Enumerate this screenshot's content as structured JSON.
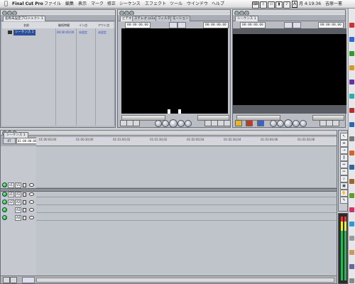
{
  "menubar": {
    "app_name": "Final Cut Pro",
    "items": [
      "ファイル",
      "編集",
      "表示",
      "マーク",
      "修正",
      "シーケンス",
      "エフェクト",
      "ツール",
      "ウインドウ",
      "ヘルプ"
    ],
    "status_a": "A",
    "time": "月 4:19:36",
    "user": "吉原一憲"
  },
  "browser": {
    "title": "ブラウザ",
    "tab_label": "名称未設定プロジェクト 1",
    "columns": [
      "名前",
      "継続時間",
      "イン点",
      "アウト点"
    ],
    "rows": [
      {
        "name": "シーケンス 1",
        "duration": "00:00:00;00",
        "in": "未設定",
        "out": "未設定"
      }
    ]
  },
  "viewer": {
    "tabs": [
      "ビデオ",
      "ステレオ (a1a2)",
      "フィルタ",
      "モーション"
    ],
    "timecode_left": "00:00:00;00",
    "timecode_right": "00:00:00;00"
  },
  "canvas": {
    "tab_label": "シーケンス 1",
    "timecode_left": "00:00:00;00",
    "timecode_right": "00:00:00;00"
  },
  "timeline": {
    "sequence_tab": "シーケンス 1",
    "rt_label": "RT",
    "timecode": "01:00:00;00",
    "ruler_ticks": [
      "01:00:00;00",
      "01:00:30;00",
      "01:01:00;02",
      "01:01:30;02",
      "01:02:00;04",
      "01:02:30;04",
      "01:03:00;06",
      "01:03:30;06"
    ],
    "video_tracks": [
      {
        "src": "v1",
        "dst": "V1"
      }
    ],
    "audio_tracks": [
      {
        "src": "a1",
        "dst": "A1"
      },
      {
        "src": "a2",
        "dst": "A2"
      },
      {
        "dst": "A3"
      },
      {
        "dst": "A4"
      }
    ]
  }
}
